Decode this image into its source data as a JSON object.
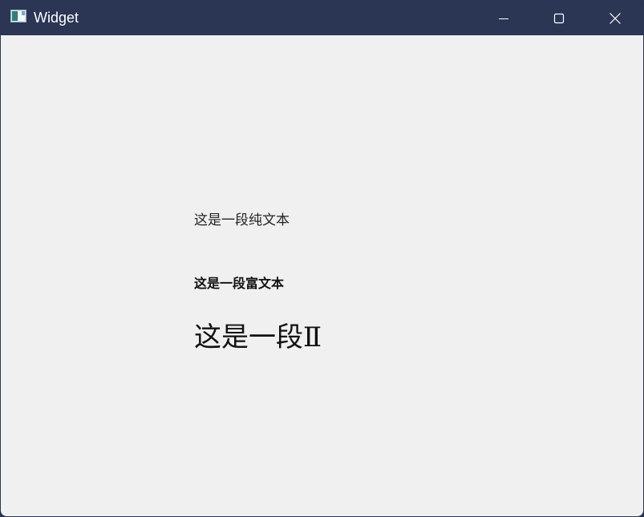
{
  "window": {
    "title": "Widget",
    "icon": "app-window-icon",
    "controls": {
      "minimize_icon": "minimize-icon",
      "maximize_icon": "maximize-icon",
      "close_icon": "close-icon"
    }
  },
  "content": {
    "plain_text": "这是一段纯文本",
    "rich_text_bold": "这是一段富文本",
    "rich_text_large": "这是一段Ⅱ"
  },
  "colors": {
    "titlebar": "#2b3554",
    "client_background": "#f0f0f0",
    "text": "#111111"
  }
}
